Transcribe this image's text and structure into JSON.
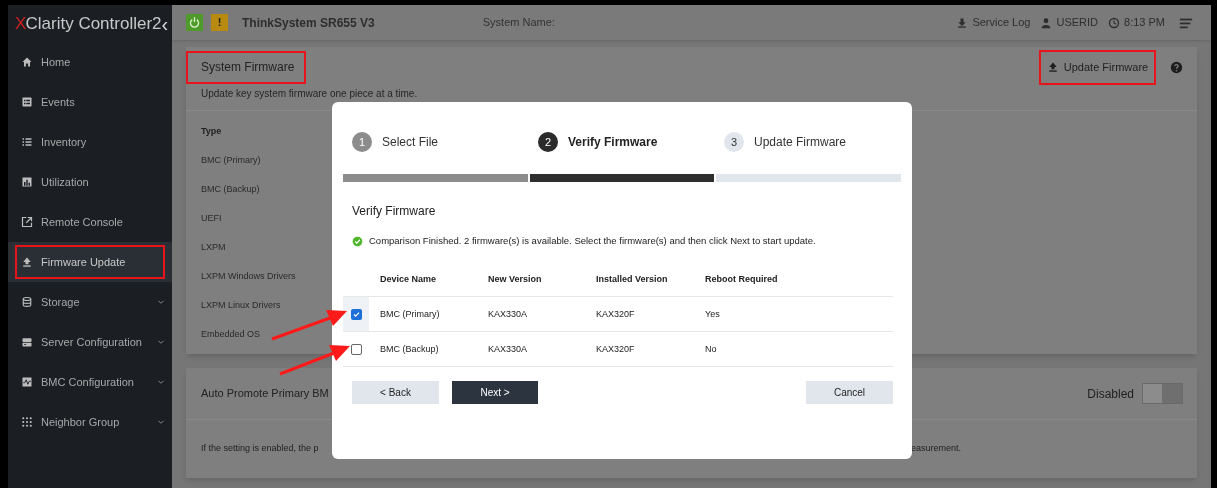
{
  "sidebar": {
    "logo_mark": "X",
    "logo_text": "Clarity",
    "logo_suffix": "Controller2",
    "collapse": "‹",
    "items": [
      {
        "label": "Home",
        "kind": "home",
        "expandable": false,
        "selected": false,
        "highlighted": false
      },
      {
        "label": "Events",
        "kind": "events",
        "expandable": false,
        "selected": false,
        "highlighted": false
      },
      {
        "label": "Inventory",
        "kind": "list",
        "expandable": false,
        "selected": false,
        "highlighted": false
      },
      {
        "label": "Utilization",
        "kind": "chart",
        "expandable": false,
        "selected": false,
        "highlighted": false
      },
      {
        "label": "Remote Console",
        "kind": "external",
        "expandable": false,
        "selected": false,
        "highlighted": false
      },
      {
        "label": "Firmware Update",
        "kind": "upload",
        "expandable": false,
        "selected": true,
        "highlighted": true
      },
      {
        "label": "Storage",
        "kind": "database",
        "expandable": true,
        "selected": false,
        "highlighted": false
      },
      {
        "label": "Server Configuration",
        "kind": "server",
        "expandable": true,
        "selected": false,
        "highlighted": false
      },
      {
        "label": "BMC Configuration",
        "kind": "pulse",
        "expandable": true,
        "selected": false,
        "highlighted": false
      },
      {
        "label": "Neighbor Group",
        "kind": "grid",
        "expandable": true,
        "selected": false,
        "highlighted": false
      }
    ]
  },
  "header": {
    "warning": "!",
    "model": "ThinkSystem SR655 V3",
    "system_name_label": "System Name:",
    "service_log": "Service Log",
    "user": "USERID",
    "time": "8:13 PM"
  },
  "firmware_card": {
    "title": "System Firmware",
    "title_highlighted": true,
    "update_button": "Update Firmware",
    "update_highlighted": true,
    "description": "Update key system firmware one piece at a time.",
    "type_header": "Type",
    "types": [
      "BMC (Primary)",
      "BMC (Backup)",
      "UEFI",
      "LXPM",
      "LXPM Windows Drivers",
      "LXPM Linux Drivers",
      "Embedded OS"
    ]
  },
  "auto_promote_card": {
    "title": "Auto Promote Primary BM",
    "toggle_label": "Disabled",
    "on": false,
    "description_left": "If the setting is enabled, the p",
    "description_right": "easurement."
  },
  "dialog": {
    "steps": [
      {
        "number": "1",
        "label": "Select File",
        "kind": "done"
      },
      {
        "number": "2",
        "label": "Verify Firmware",
        "kind": "current"
      },
      {
        "number": "3",
        "label": "Update Firmware",
        "kind": "todo"
      }
    ],
    "heading": "Verify Firmware",
    "status": "Comparison Finished. 2 firmware(s) is available. Select the firmware(s) and then click Next to start update.",
    "columns": [
      "Device Name",
      "New Version",
      "Installed Version",
      "Reboot Required"
    ],
    "rows": [
      {
        "checked": true,
        "cells": [
          "BMC (Primary)",
          "KAX330A",
          "KAX320F",
          "Yes"
        ]
      },
      {
        "checked": false,
        "cells": [
          "BMC (Backup)",
          "KAX330A",
          "KAX320F",
          "No"
        ]
      }
    ],
    "back": "< Back",
    "next": "Next >",
    "cancel": "Cancel"
  }
}
